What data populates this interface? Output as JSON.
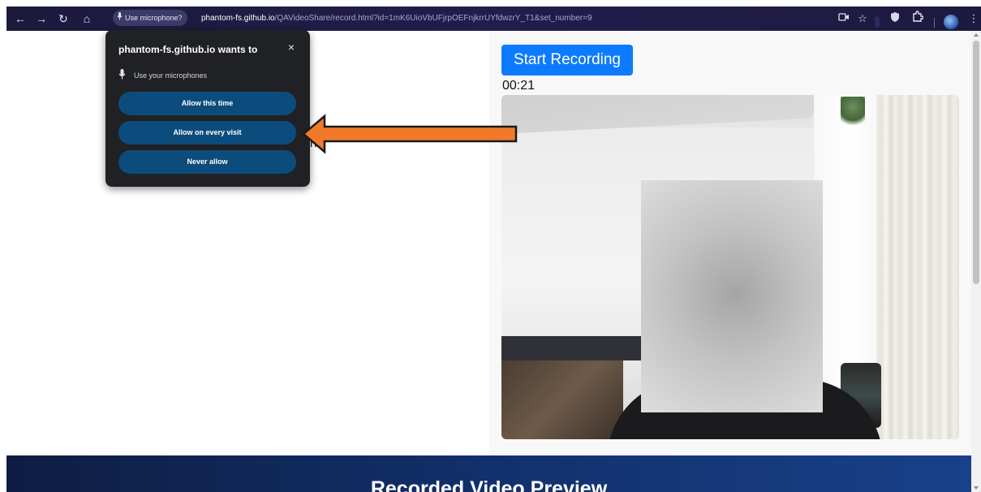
{
  "browser": {
    "nav": {
      "back": "←",
      "forward": "→",
      "reload": "↻",
      "home": "⌂"
    },
    "mic_chip": {
      "icon": "microphone-icon",
      "label": "Use microphone?"
    },
    "url": {
      "domain": "phantom-fs.github.io",
      "path": "/QAVideoShare/record.html?id=1mK6UioVbUFjrpOEFnjkrrUYfdwzrY_T1&set_number=9"
    },
    "tools": [
      "camera-icon",
      "star-icon",
      "shield-icon",
      "extensions-icon",
      "profile-avatar",
      "more-menu-icon"
    ]
  },
  "popup": {
    "title": "phantom-fs.github.io wants to",
    "close": "×",
    "permission": "Use your microphones",
    "buttons": {
      "allow_once": "Allow this time",
      "allow_always": "Allow on every visit",
      "never": "Never allow"
    }
  },
  "page": {
    "partial_text": "n:",
    "start_button": "Start Recording",
    "timer": "00:21",
    "banner_title": "Recorded Video Preview"
  },
  "colors": {
    "accent_button": "#0d7bff",
    "popup_bg": "#202124",
    "popup_button": "#0c4c7d",
    "arrow": "#f07a2a"
  }
}
